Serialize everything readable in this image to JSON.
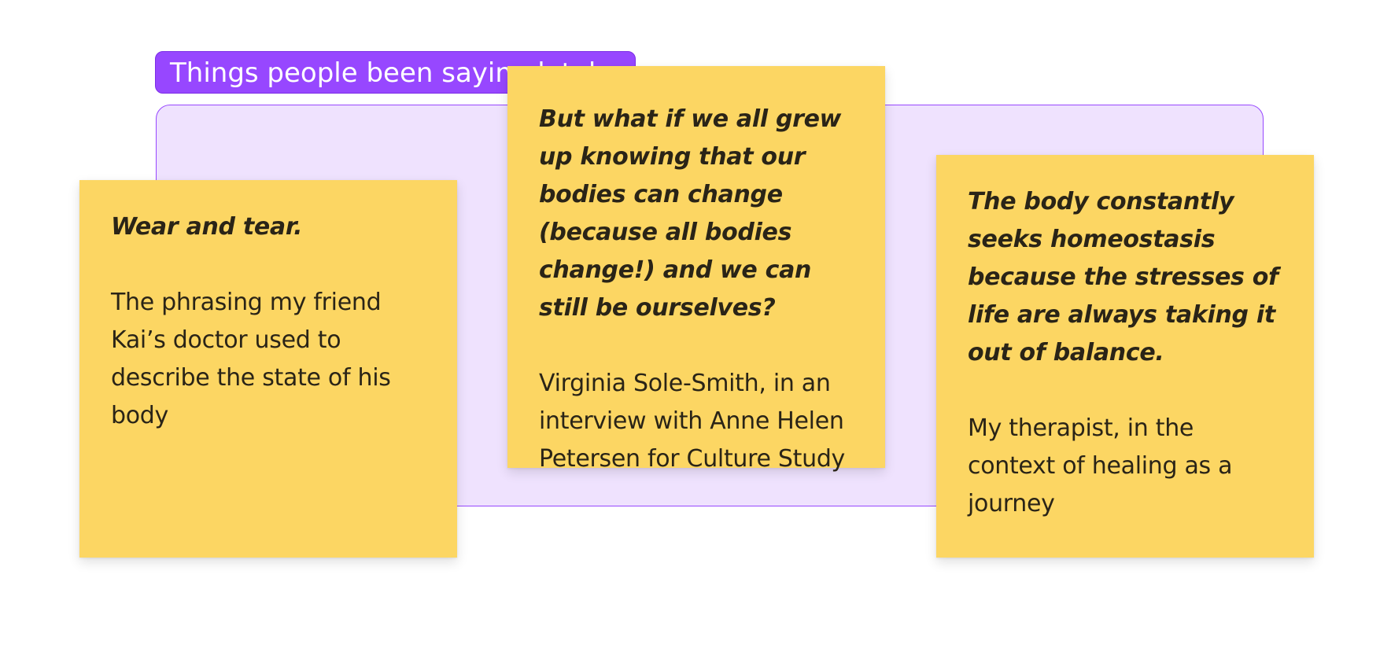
{
  "section": {
    "title": "Things people been saying lately"
  },
  "stickies": [
    {
      "quote": "Wear and tear.",
      "attribution": "The phrasing my friend Kai’s doctor used to describe the state of his body"
    },
    {
      "quote": "But what if we all grew up knowing that our bodies can change (because all bodies change!) and we can still be ourselves?",
      "attribution": "Virginia Sole-Smith, in an interview with Anne Helen Petersen for Culture Study"
    },
    {
      "quote": "The body constantly seeks homeostasis because the stresses of life are always taking it out of balance.",
      "attribution": "My therapist, in the context of healing as a journey"
    }
  ],
  "colors": {
    "section_fill": "#efe2fe",
    "section_accent": "#9747ff",
    "sticky_fill": "#fcd663",
    "text": "#2a2417"
  }
}
